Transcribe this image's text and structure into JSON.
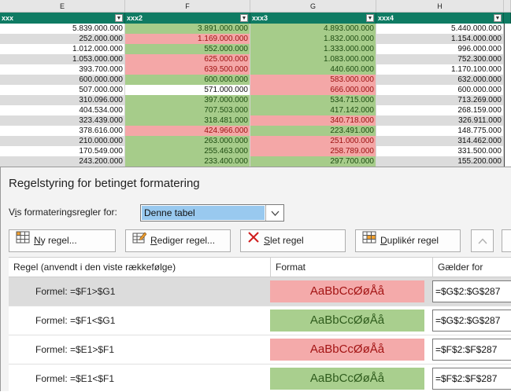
{
  "spreadsheet": {
    "column_letters": [
      "E",
      "F",
      "G",
      "H"
    ],
    "table_headers": [
      "xxx",
      "xxx2",
      "xxx3",
      "xxx4"
    ],
    "rows": [
      [
        "5.839.000.000",
        "3.891.000.000",
        "4.893.000.000",
        "5.440.000.000"
      ],
      [
        "252.000.000",
        "1.169.000.000",
        "1.832.000.000",
        "1.154.000.000"
      ],
      [
        "1.012.000.000",
        "552.000.000",
        "1.333.000.000",
        "996.000.000"
      ],
      [
        "1.053.000.000",
        "625.000.000",
        "1.083.000.000",
        "752.300.000"
      ],
      [
        "393.700.000",
        "639.500.000",
        "440.600.000",
        "1.170.100.000"
      ],
      [
        "600.000.000",
        "600.000.000",
        "583.000.000",
        "632.000.000"
      ],
      [
        "507.000.000",
        "571.000.000",
        "666.000.000",
        "600.000.000"
      ],
      [
        "310.096.000",
        "397.000.000",
        "534.715.000",
        "713.269.000"
      ],
      [
        "404.534.000",
        "707.503.000",
        "417.142.000",
        "268.159.000"
      ],
      [
        "323.439.000",
        "318.481.000",
        "340.718.000",
        "326.911.000"
      ],
      [
        "378.616.000",
        "424.966.000",
        "223.491.000",
        "148.775.000"
      ],
      [
        "210.000.000",
        "263.000.000",
        "251.000.000",
        "314.462.000"
      ],
      [
        "170.549.000",
        "255.463.000",
        "258.789.000",
        "331.500.000"
      ],
      [
        "243.200.000",
        "233.400.000",
        "297.700.000",
        "155.200.000"
      ]
    ],
    "f_colors": [
      "green",
      "red",
      "green",
      "red",
      "red",
      "green",
      "none",
      "green",
      "green",
      "green",
      "red",
      "green",
      "green",
      "green"
    ],
    "g_colors": [
      "green",
      "green",
      "green",
      "green",
      "green",
      "red",
      "red",
      "green",
      "green",
      "red",
      "green",
      "red",
      "red",
      "green"
    ]
  },
  "dialog": {
    "title": "Regelstyring for betinget formatering",
    "show_label_pre": "V",
    "show_label_u": "i",
    "show_label_post": "s formateringsregler for:",
    "show_value": "Denne tabel",
    "buttons": {
      "new_u": "N",
      "new_rest": "y regel...",
      "edit_u": "R",
      "edit_rest": "ediger regel...",
      "delete_u": "S",
      "delete_rest": "let regel",
      "dup_u": "D",
      "dup_rest": "uplikér regel"
    },
    "columns": {
      "rule": "Regel (anvendt i den viste rækkefølge)",
      "format": "Format",
      "applies": "Gælder for"
    },
    "rules": [
      {
        "formula": "Formel: =$F1>$G1",
        "preview": "AaBbCcØøÅå",
        "color": "red",
        "applies_to": "=$G$2:$G$287",
        "selected": true
      },
      {
        "formula": "Formel: =$F1<$G1",
        "preview": "AaBbCcØøÅå",
        "color": "green",
        "applies_to": "=$G$2:$G$287",
        "selected": false
      },
      {
        "formula": "Formel: =$E1>$F1",
        "preview": "AaBbCcØøÅå",
        "color": "red",
        "applies_to": "=$F$2:$F$287",
        "selected": false
      },
      {
        "formula": "Formel: =$E1<$F1",
        "preview": "AaBbCcØøÅå",
        "color": "green",
        "applies_to": "=$F$2:$F$287",
        "selected": false
      }
    ]
  }
}
